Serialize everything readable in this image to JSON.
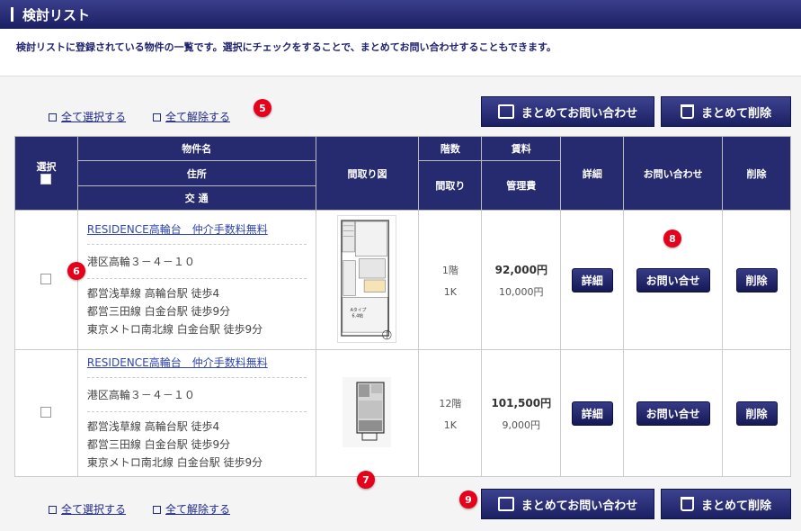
{
  "header": {
    "title": "検討リスト"
  },
  "intro": "検討リストに登録されている物件の一覧です。選択にチェックをすることで、まとめてお問い合わせすることもできます。",
  "selection": {
    "select_all": "全て選択する",
    "deselect_all": "全て解除する"
  },
  "actions": {
    "bulk_inquiry": "まとめてお問い合わせ",
    "bulk_delete": "まとめて削除"
  },
  "markers": [
    "5",
    "6",
    "7",
    "8",
    "9"
  ],
  "table": {
    "headers": {
      "select": "選択",
      "name": "物件名",
      "address": "住所",
      "transport": "交 通",
      "floorplan": "間取り図",
      "floor": "階数",
      "layout": "間取り",
      "rent": "賃料",
      "fee": "管理費",
      "detail": "詳細",
      "inquiry": "お問い合わせ",
      "delete": "削除"
    },
    "rows": [
      {
        "name": "RESIDENCE高輪台　仲介手数料無料",
        "address": "港区高輪３－４－１０",
        "stations": [
          "都営浅草線 高輪台駅 徒歩4",
          "都営三田線 白金台駅 徒歩9分",
          "東京メトロ南北線 白金台駅 徒歩9分"
        ],
        "floor": "1階",
        "layout": "1K",
        "rent": "92,000円",
        "fee": "10,000円",
        "plan_label": "Aタイプ\n6.4帖",
        "detail_label": "詳細",
        "inquiry_label": "お問い合せ",
        "delete_label": "削除"
      },
      {
        "name": "RESIDENCE高輪台　仲介手数料無料",
        "address": "港区高輪３－４－１０",
        "stations": [
          "都営浅草線 高輪台駅 徒歩4",
          "都営三田線 白金台駅 徒歩9分",
          "東京メトロ南北線 白金台駅 徒歩9分"
        ],
        "floor": "12階",
        "layout": "1K",
        "rent": "101,500円",
        "fee": "9,000円",
        "detail_label": "詳細",
        "inquiry_label": "お問い合せ",
        "delete_label": "削除"
      }
    ]
  }
}
